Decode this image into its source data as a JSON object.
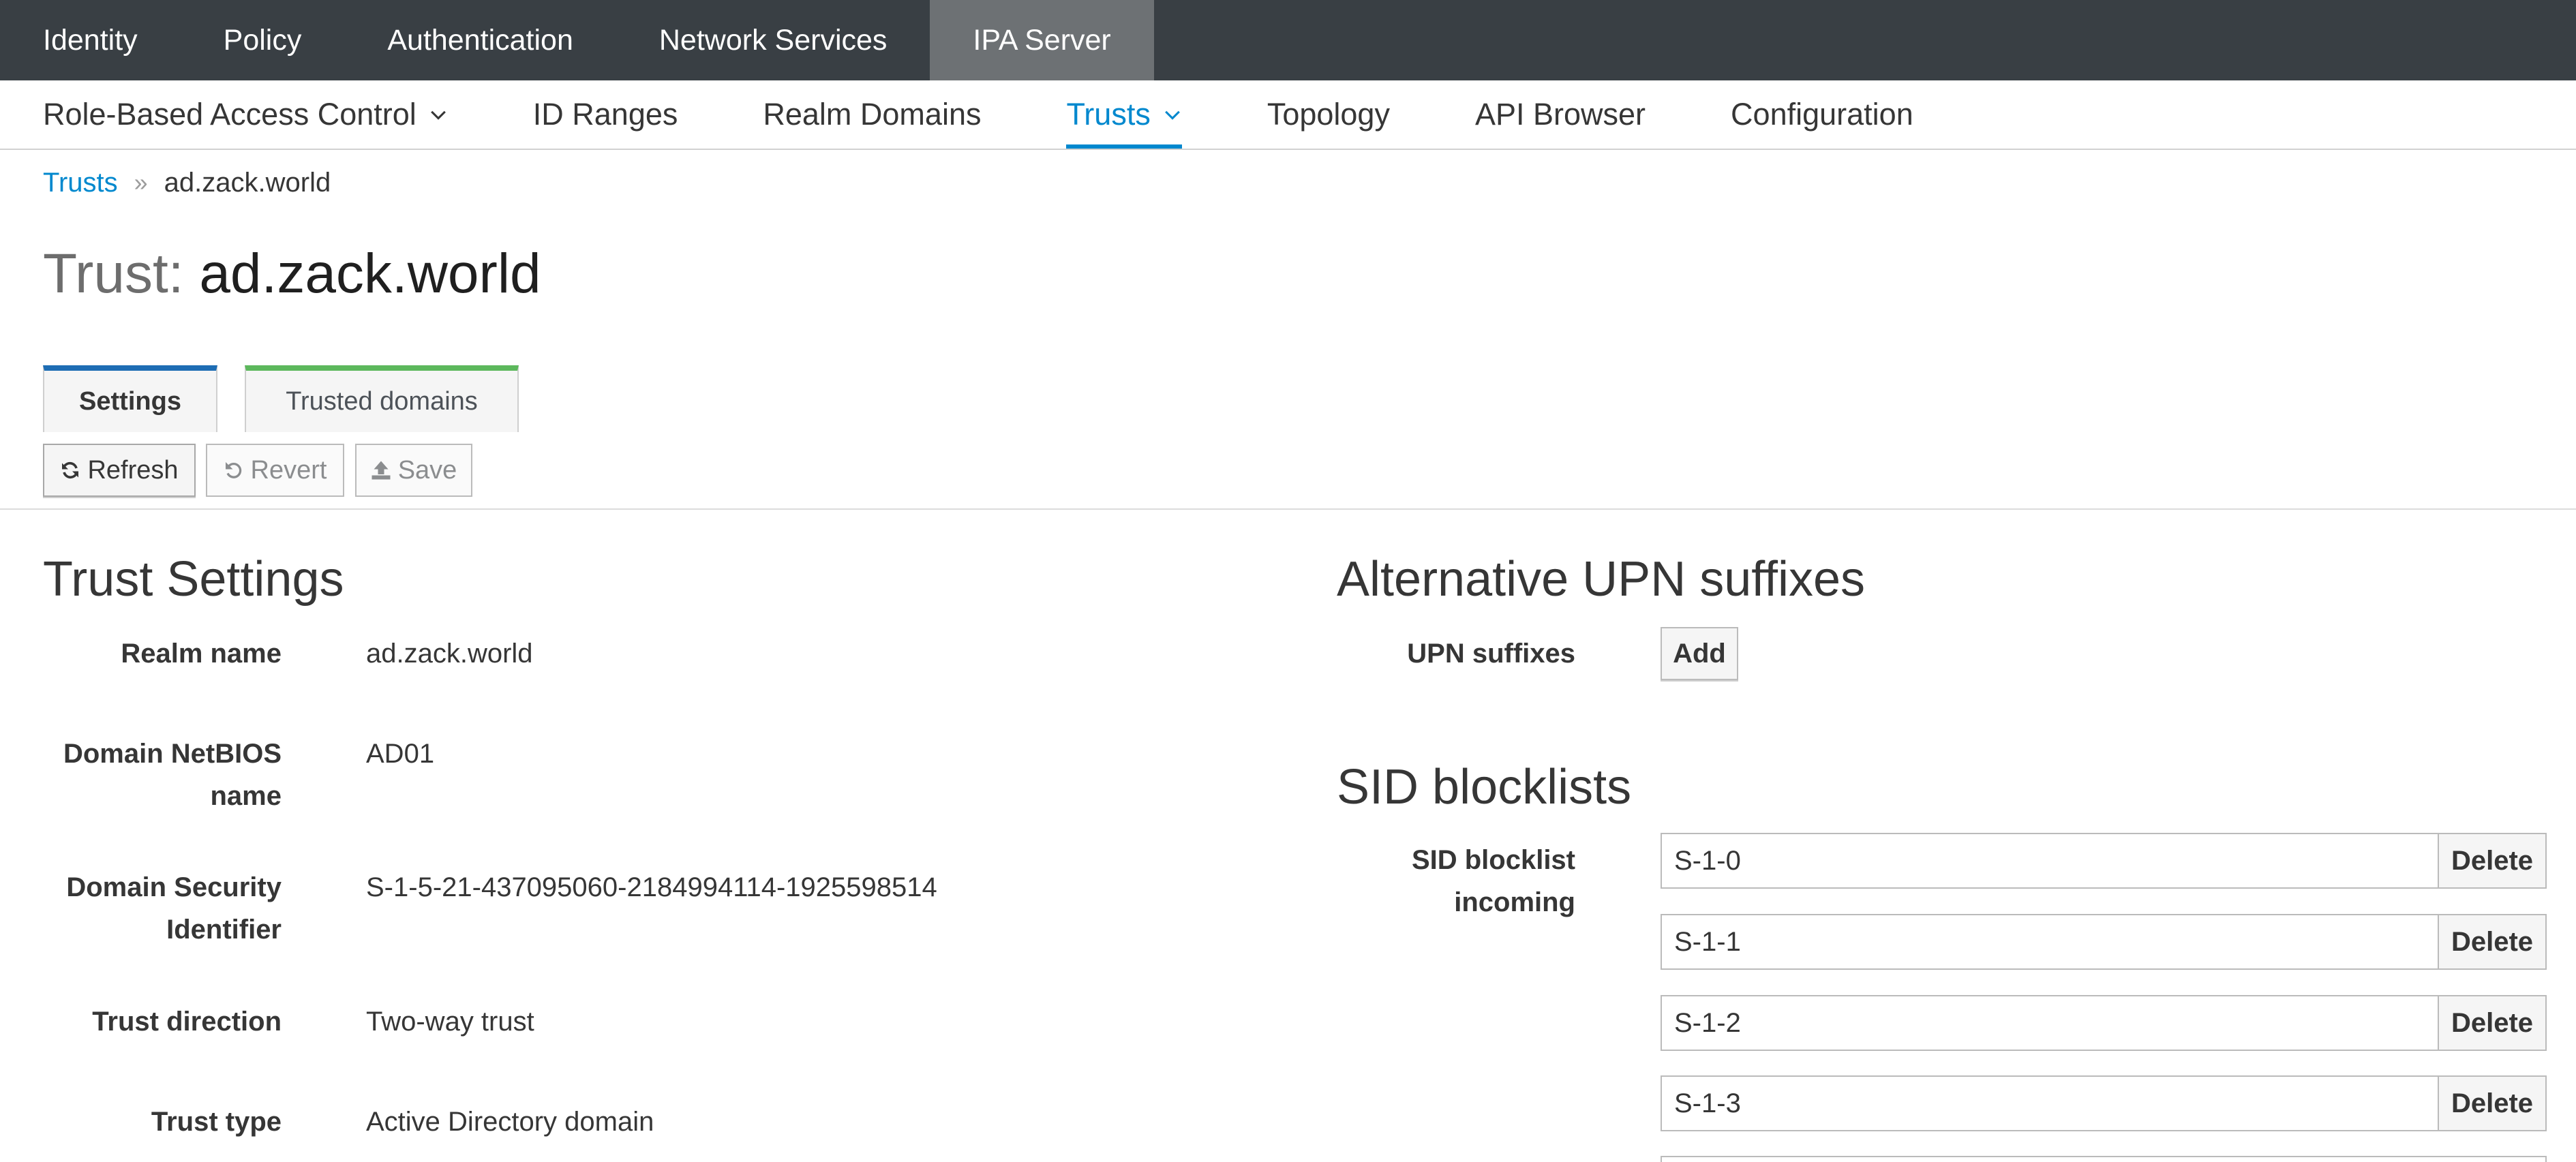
{
  "topnav": {
    "items": [
      {
        "label": "Identity",
        "active": false
      },
      {
        "label": "Policy",
        "active": false
      },
      {
        "label": "Authentication",
        "active": false
      },
      {
        "label": "Network Services",
        "active": false
      },
      {
        "label": "IPA Server",
        "active": true
      }
    ]
  },
  "subnav": {
    "items": [
      {
        "label": "Role-Based Access Control",
        "dropdown": true,
        "active": false
      },
      {
        "label": "ID Ranges",
        "dropdown": false,
        "active": false
      },
      {
        "label": "Realm Domains",
        "dropdown": false,
        "active": false
      },
      {
        "label": "Trusts",
        "dropdown": true,
        "active": true
      },
      {
        "label": "Topology",
        "dropdown": false,
        "active": false
      },
      {
        "label": "API Browser",
        "dropdown": false,
        "active": false
      },
      {
        "label": "Configuration",
        "dropdown": false,
        "active": false
      }
    ]
  },
  "breadcrumb": {
    "parent": "Trusts",
    "separator": "»",
    "current": "ad.zack.world"
  },
  "page": {
    "title_prefix": "Trust:",
    "title_name": "ad.zack.world"
  },
  "tabs": {
    "settings": "Settings",
    "trusted_domains": "Trusted domains"
  },
  "toolbar": {
    "refresh": "Refresh",
    "revert": "Revert",
    "save": "Save"
  },
  "trust_settings": {
    "title": "Trust Settings",
    "fields": [
      {
        "label": "Realm name",
        "value": "ad.zack.world"
      },
      {
        "label": "Domain NetBIOS name",
        "value": "AD01"
      },
      {
        "label": "Domain Security Identifier",
        "value": "S-1-5-21-437095060-2184994114-1925598514"
      },
      {
        "label": "Trust direction",
        "value": "Two-way trust"
      },
      {
        "label": "Trust type",
        "value": "Active Directory domain"
      }
    ]
  },
  "upn": {
    "title": "Alternative UPN suffixes",
    "label": "UPN suffixes",
    "add_label": "Add"
  },
  "sid_blocklists": {
    "title": "SID blocklists",
    "incoming_label": "SID blocklist incoming",
    "delete_label": "Delete",
    "incoming": [
      "S-1-0",
      "S-1-1",
      "S-1-2",
      "S-1-3"
    ]
  },
  "colors": {
    "topnav_bg": "#393f44",
    "topnav_active_bg": "#6d7174",
    "accent": "#0088ce",
    "settings_tab_accent": "#1e6db4",
    "trusted_tab_accent": "#5cb85c"
  }
}
